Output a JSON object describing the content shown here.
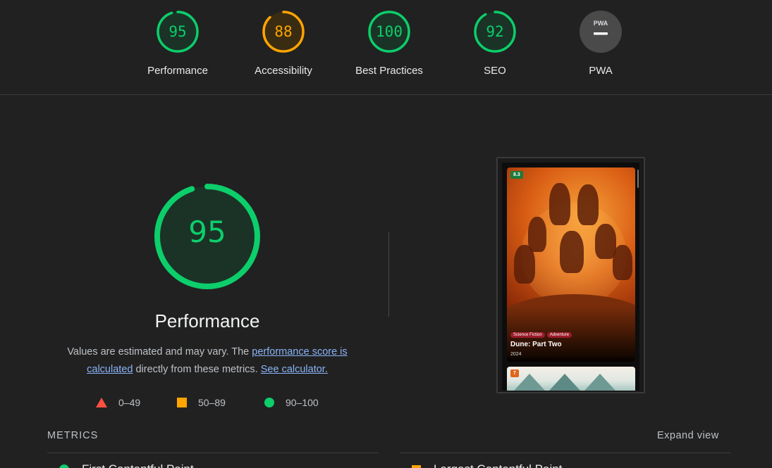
{
  "colors": {
    "pass": "#0cce6b",
    "average": "#ffa400",
    "fail": "#ff4e42",
    "na": "#9aa0a6"
  },
  "categories": [
    {
      "label": "Performance",
      "score": "95",
      "value": 95,
      "status": "pass"
    },
    {
      "label": "Accessibility",
      "score": "88",
      "value": 88,
      "status": "average"
    },
    {
      "label": "Best Practices",
      "score": "100",
      "value": 100,
      "status": "pass"
    },
    {
      "label": "SEO",
      "score": "92",
      "value": 92,
      "status": "pass"
    },
    {
      "label": "PWA",
      "score": "",
      "value": 0,
      "status": "na",
      "badge_text": "PWA"
    }
  ],
  "main": {
    "score": "95",
    "title": "Performance",
    "desc_prefix": "Values are estimated and may vary. The ",
    "link_score": "performance score is calculated",
    "desc_middle": " directly from these metrics. ",
    "link_calc": "See calculator."
  },
  "legend": [
    {
      "icon": "red-triangle-icon",
      "range": "0–49"
    },
    {
      "icon": "orange-square-icon",
      "range": "50–89"
    },
    {
      "icon": "green-circle-icon",
      "range": "90–100"
    }
  ],
  "thumbnail": {
    "rating": "8.3",
    "tags": [
      "Science Fiction",
      "Adventure"
    ],
    "movie_title": "Dune: Part Two",
    "year": "2024",
    "second_rating": "7"
  },
  "metrics": {
    "label": "METRICS",
    "expand": "Expand view",
    "items": [
      {
        "name": "First Contentful Paint",
        "status": "pass"
      },
      {
        "name": "Largest Contentful Paint",
        "status": "average"
      }
    ]
  }
}
